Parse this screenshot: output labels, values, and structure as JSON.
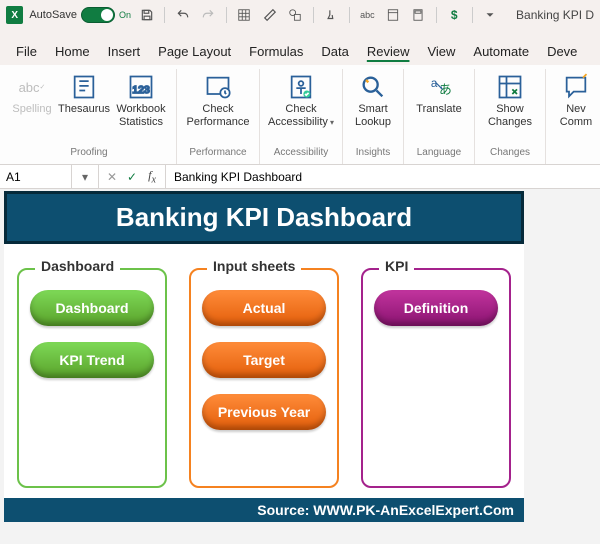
{
  "titlebar": {
    "autosave_label": "AutoSave",
    "autosave_on": "On",
    "doc_title": "Banking KPI D"
  },
  "tabs": {
    "file": "File",
    "home": "Home",
    "insert": "Insert",
    "page_layout": "Page Layout",
    "formulas": "Formulas",
    "data": "Data",
    "review": "Review",
    "view": "View",
    "automate": "Automate",
    "developer": "Deve"
  },
  "ribbon": {
    "proofing": {
      "label": "Proofing",
      "spelling": "Spelling",
      "thesaurus": "Thesaurus",
      "workbook_stats": "Workbook\nStatistics"
    },
    "performance": {
      "label": "Performance",
      "check_perf": "Check\nPerformance"
    },
    "accessibility": {
      "label": "Accessibility",
      "check_access": "Check\nAccessibility"
    },
    "insights": {
      "label": "Insights",
      "smart_lookup": "Smart\nLookup"
    },
    "language": {
      "label": "Language",
      "translate": "Translate"
    },
    "changes": {
      "label": "Changes",
      "show_changes": "Show\nChanges"
    },
    "comments": {
      "new_comment": "Nev\nComm"
    }
  },
  "formula_bar": {
    "name_box": "A1",
    "formula": "Banking KPI Dashboard"
  },
  "dashboard": {
    "title": "Banking KPI Dashboard",
    "col1": {
      "heading": "Dashboard",
      "btn1": "Dashboard",
      "btn2": "KPI Trend"
    },
    "col2": {
      "heading": "Input sheets",
      "btn1": "Actual",
      "btn2": "Target",
      "btn3": "Previous Year"
    },
    "col3": {
      "heading": "KPI",
      "btn1": "Definition"
    },
    "footer": "Source: WWW.PK-AnExcelExpert.Com"
  }
}
